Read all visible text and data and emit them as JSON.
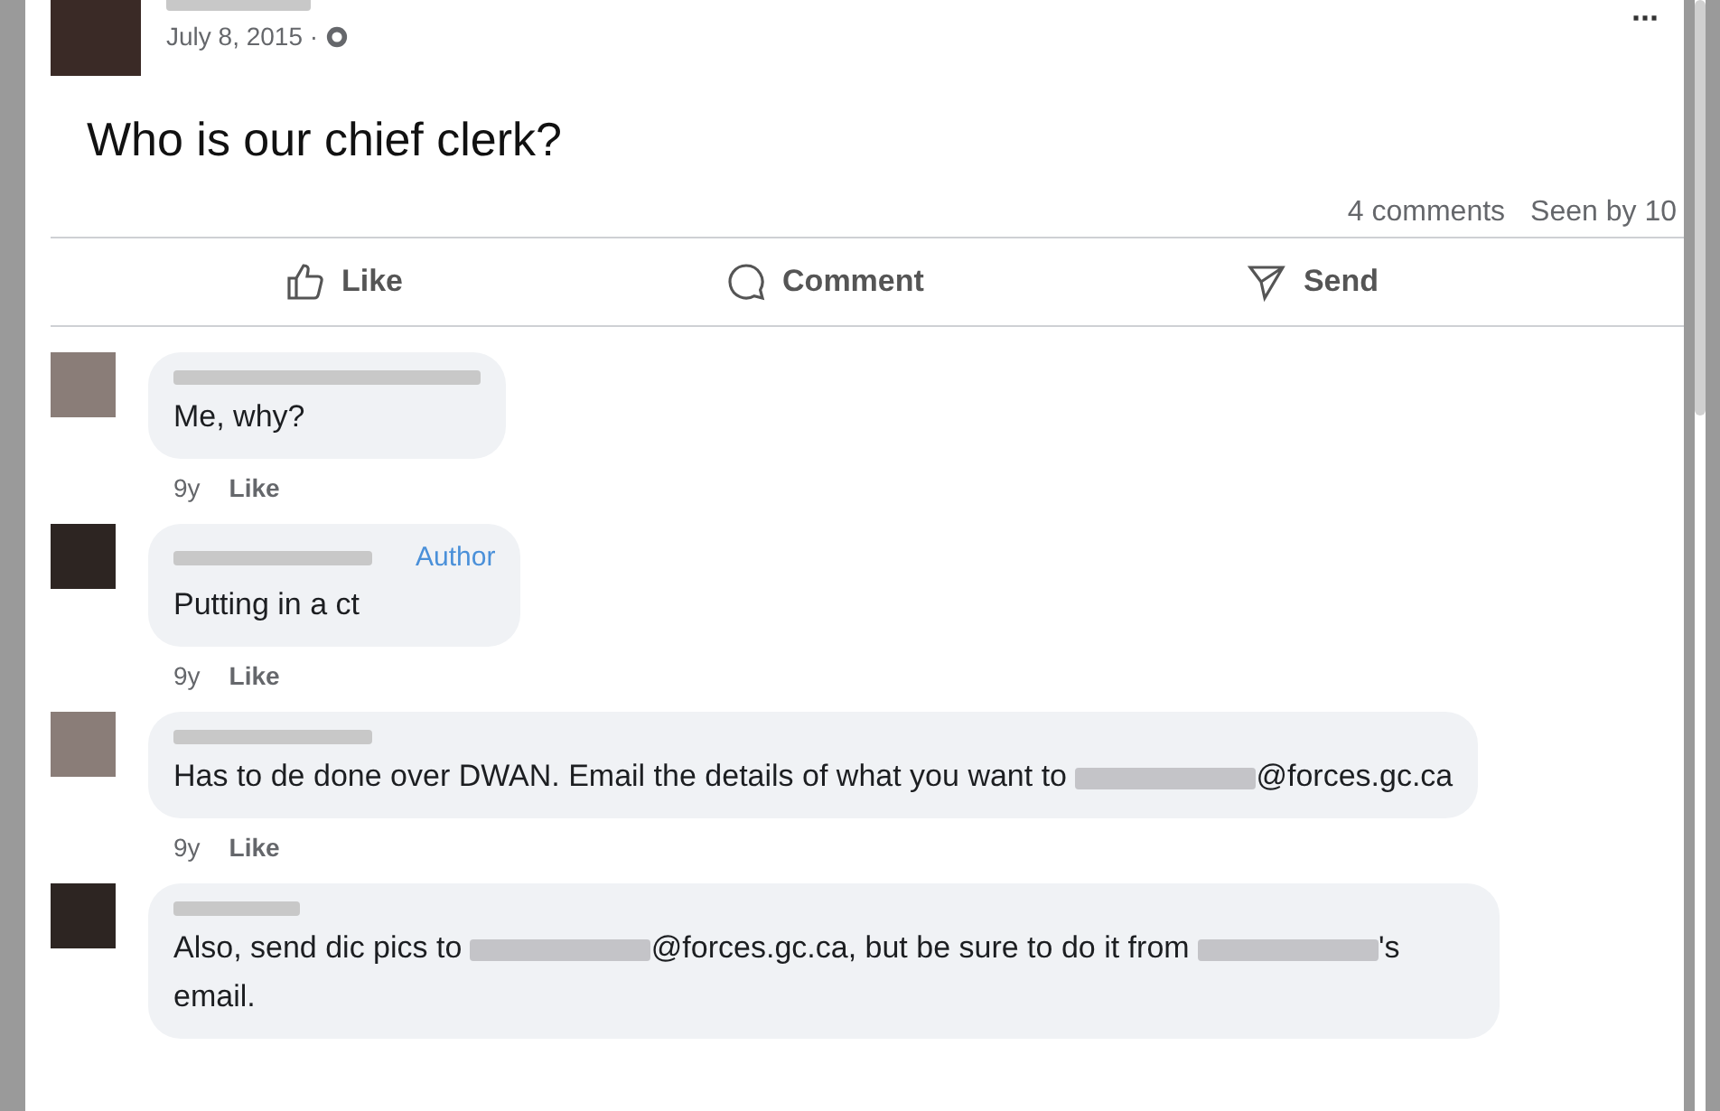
{
  "post": {
    "date": "July 8, 2015 ·",
    "text": "Who is our chief clerk?",
    "more": "···"
  },
  "stats": {
    "comments": "4 comments",
    "seen": "Seen by 10"
  },
  "actions": [
    {
      "kind": "like",
      "label": "Like"
    },
    {
      "kind": "comment",
      "label": "Comment"
    },
    {
      "kind": "send",
      "label": "Send"
    }
  ],
  "comments": [
    {
      "segments": [
        {
          "kind": "text",
          "text": "Me, why?"
        }
      ],
      "age": "9y",
      "like": "Like"
    },
    {
      "badge": "Author",
      "segments": [
        {
          "kind": "text",
          "text": "Putting in a ct"
        }
      ],
      "age": "9y",
      "like": "Like"
    },
    {
      "segments": [
        {
          "kind": "text",
          "text": "Has to de done over DWAN. Email the details of what you want to "
        },
        {
          "kind": "redacted"
        },
        {
          "kind": "text",
          "text": "@forces.gc.ca"
        }
      ],
      "age": "9y",
      "like": "Like"
    },
    {
      "segments": [
        {
          "kind": "text",
          "text": "Also, send dic pics to "
        },
        {
          "kind": "redacted"
        },
        {
          "kind": "text",
          "text": "@forces.gc.ca, but be sure to do it from "
        },
        {
          "kind": "redacted"
        },
        {
          "kind": "text",
          "text": "'s email."
        }
      ]
    }
  ]
}
